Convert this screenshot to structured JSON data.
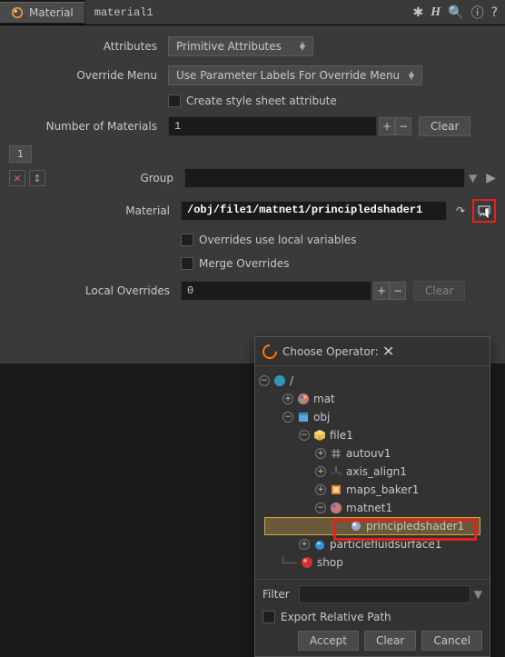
{
  "header": {
    "tab_label": "Material",
    "node_name": "material1"
  },
  "toolbar_icons": {
    "gear": "gear-icon",
    "h": "houdini-help-icon",
    "search": "search-icon",
    "info": "info-icon",
    "help": "help-icon"
  },
  "params": {
    "attributes": {
      "label": "Attributes",
      "value": "Primitive Attributes"
    },
    "override_menu": {
      "label": "Override Menu",
      "value": "Use Parameter Labels For Override Menu"
    },
    "create_style": {
      "label": "Create style sheet attribute",
      "checked": false
    },
    "num_materials": {
      "label": "Number of Materials",
      "value": "1",
      "clear": "Clear"
    },
    "seq_tab": "1",
    "group": {
      "label": "Group",
      "value": ""
    },
    "material": {
      "label": "Material",
      "value": "/obj/file1/matnet1/principledshader1"
    },
    "overrides_local": {
      "label": "Overrides use local variables",
      "checked": false
    },
    "merge_overrides": {
      "label": "Merge Overrides",
      "checked": false
    },
    "local_overrides": {
      "label": "Local Overrides",
      "value": "0",
      "clear": "Clear"
    }
  },
  "chooser": {
    "title": "Choose Operator:",
    "tree": {
      "root": "/",
      "items": [
        {
          "depth": 1,
          "exp": "+",
          "icon": "palette",
          "label": "mat"
        },
        {
          "depth": 1,
          "exp": "-",
          "icon": "geo",
          "label": "obj"
        },
        {
          "depth": 2,
          "exp": "-",
          "icon": "cube",
          "label": "file1"
        },
        {
          "depth": 3,
          "exp": "+",
          "icon": "uv",
          "label": "autouv1"
        },
        {
          "depth": 3,
          "exp": "+",
          "icon": "axis",
          "label": "axis_align1"
        },
        {
          "depth": 3,
          "exp": "+",
          "icon": "baker",
          "label": "maps_baker1"
        },
        {
          "depth": 3,
          "exp": "-",
          "icon": "matnet",
          "label": "matnet1"
        },
        {
          "depth": 4,
          "exp": "",
          "icon": "shader",
          "label": "principledshader1",
          "selected": true,
          "highlighted": true
        },
        {
          "depth": 2,
          "exp": "+",
          "icon": "fluid",
          "label": "particlefluidsurface1"
        },
        {
          "depth": 1,
          "exp": "",
          "icon": "shop",
          "label": "shop"
        }
      ]
    },
    "filter_label": "Filter",
    "filter_value": "",
    "export_relative": {
      "label": "Export Relative Path",
      "checked": false
    },
    "buttons": {
      "accept": "Accept",
      "clear": "Clear",
      "cancel": "Cancel"
    }
  }
}
